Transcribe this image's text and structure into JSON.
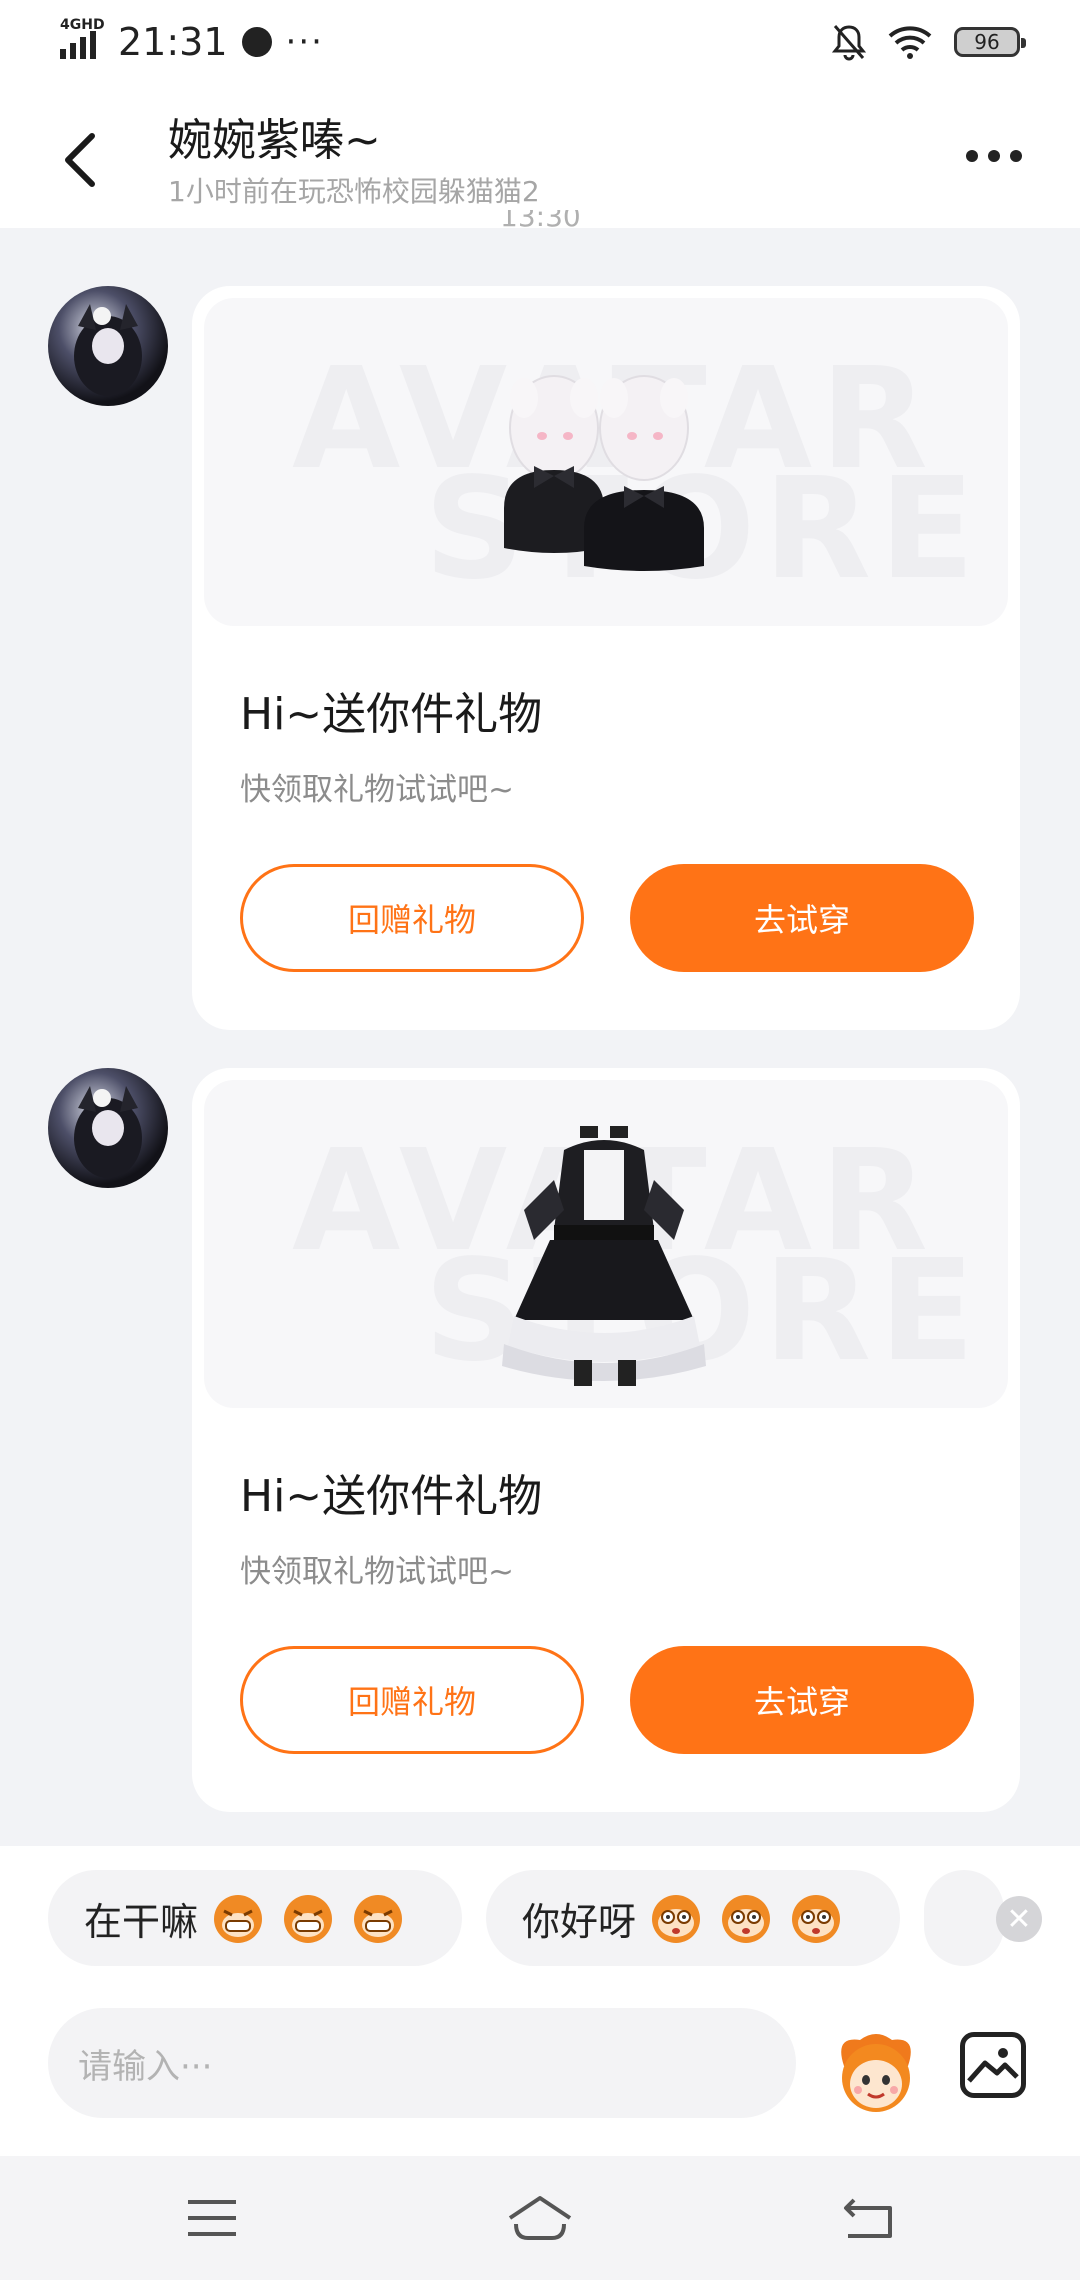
{
  "status_bar": {
    "network": "4GHD",
    "time": "21:31",
    "more": "···",
    "battery": "96"
  },
  "header": {
    "title": "婉婉紫嗪~",
    "subtitle": "1小时前在玩恐怖校园躲猫猫2"
  },
  "chat": {
    "timestamp_partial": "13:30",
    "messages": [
      {
        "title": "Hi~送你件礼物",
        "subtitle": "快领取礼物试试吧~",
        "return_gift_label": "回赠礼物",
        "try_on_label": "去试穿",
        "item_icon": "fluffy-slippers"
      },
      {
        "title": "Hi~送你件礼物",
        "subtitle": "快领取礼物试试吧~",
        "return_gift_label": "回赠礼物",
        "try_on_label": "去试穿",
        "item_icon": "maid-dress"
      }
    ]
  },
  "quick_replies": [
    {
      "text": "在干嘛",
      "emoji": "grin-monkey-emoji"
    },
    {
      "text": "你好呀",
      "emoji": "wide-eye-monkey-emoji"
    }
  ],
  "input": {
    "placeholder": "请输入···"
  },
  "colors": {
    "accent": "#ff7316",
    "background": "#f2f3f6"
  }
}
